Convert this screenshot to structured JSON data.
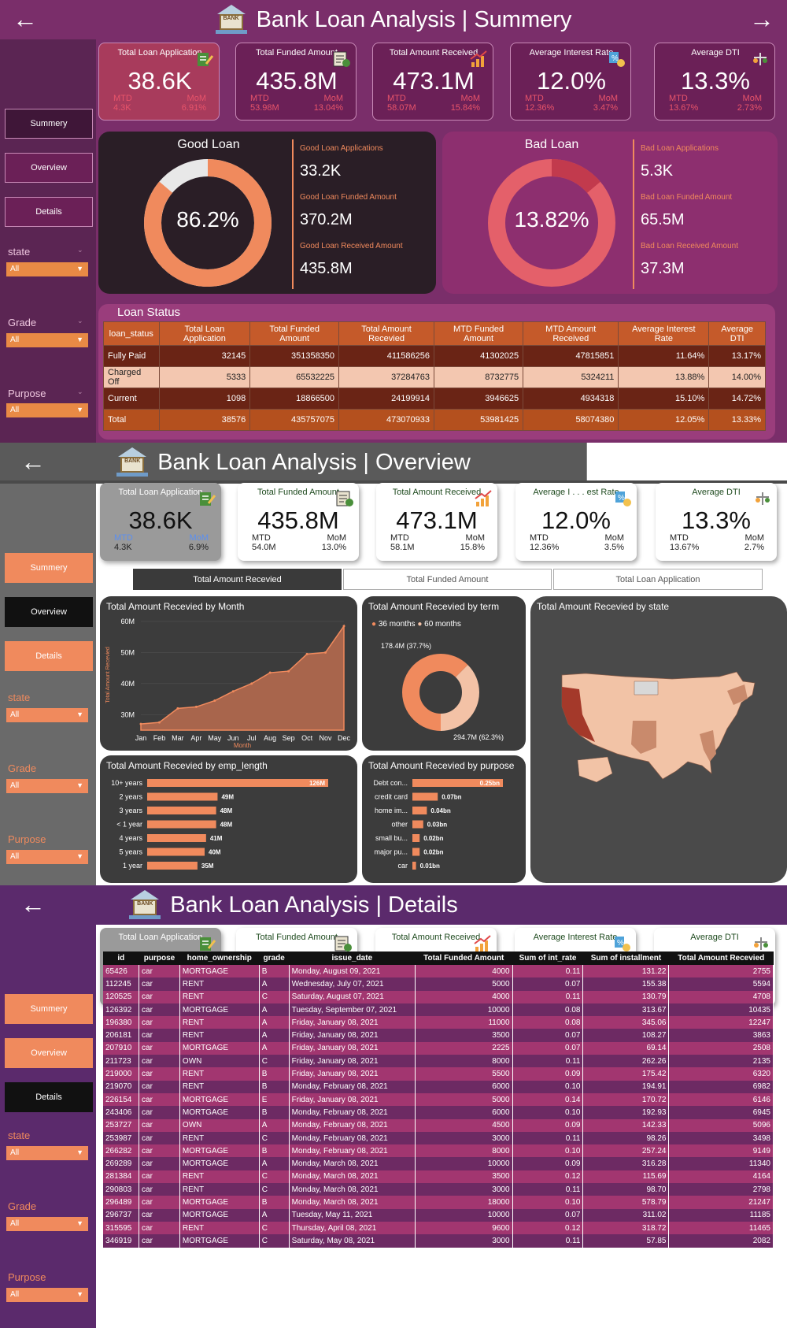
{
  "colors": {
    "summary_bg": "#7a2e6a",
    "overview_bg": "#4a4a4a",
    "details_bg": "#5b2a6c",
    "accent": "#f08a5d",
    "good": "#f08a5d",
    "bad": "#d9485b"
  },
  "summary": {
    "title": "Bank Loan Analysis | Summery",
    "nav": [
      "Summery",
      "Overview",
      "Details"
    ],
    "filters": [
      {
        "label": "state",
        "value": "All"
      },
      {
        "label": "Grade",
        "value": "All"
      },
      {
        "label": "Purpose",
        "value": "All"
      }
    ],
    "kpis": [
      {
        "title": "Total Loan Application",
        "value": "38.6K",
        "mtd_label": "MTD",
        "mtd": "4.3K",
        "mom_label": "MoM",
        "mom": "6.91%",
        "icon": "application-icon"
      },
      {
        "title": "Total Funded Amount",
        "value": "435.8M",
        "mtd_label": "MTD",
        "mtd": "53.98M",
        "mom_label": "MoM",
        "mom": "13.04%",
        "icon": "funded-icon"
      },
      {
        "title": "Total Amount Received",
        "value": "473.1M",
        "mtd_label": "MTD",
        "mtd": "58.07M",
        "mom_label": "MoM",
        "mom": "15.84%",
        "icon": "received-icon"
      },
      {
        "title": "Average Interest Rate",
        "value": "12.0%",
        "mtd_label": "MTD",
        "mtd": "12.36%",
        "mom_label": "MoM",
        "mom": "3.47%",
        "icon": "interest-icon"
      },
      {
        "title": "Average DTI",
        "value": "13.3%",
        "mtd_label": "MTD",
        "mtd": "13.67%",
        "mom_label": "MoM",
        "mom": "2.73%",
        "icon": "dti-icon"
      }
    ],
    "good": {
      "title": "Good Loan",
      "pct": "86.2%",
      "pct_value": 86.2,
      "apps_label": "Good Loan Applications",
      "apps": "33.2K",
      "funded_label": "Good Loan Funded Amount",
      "funded": "370.2M",
      "received_label": "Good Loan Received Amount",
      "received": "435.8M"
    },
    "bad": {
      "title": "Bad Loan",
      "pct": "13.82%",
      "pct_value": 13.82,
      "apps_label": "Bad Loan Applications",
      "apps": "5.3K",
      "funded_label": "Bad Loan Funded Amount",
      "funded": "65.5M",
      "received_label": "Bad Loan Received Amount",
      "received": "37.3M"
    },
    "status_title": "Loan Status",
    "status_cols": [
      "loan_status",
      "Total Loan Application",
      "Total Funded Amount",
      "Total Amount Recevied",
      "MTD Funded Amount",
      "MTD Amount Received",
      "Average Interest Rate",
      "Average DTI"
    ],
    "status_rows": [
      [
        "Fully Paid",
        "32145",
        "351358350",
        "411586256",
        "41302025",
        "47815851",
        "11.64%",
        "13.17%"
      ],
      [
        "Charged Off",
        "5333",
        "65532225",
        "37284763",
        "8732775",
        "5324211",
        "13.88%",
        "14.00%"
      ],
      [
        "Current",
        "1098",
        "18866500",
        "24199914",
        "3946625",
        "4934318",
        "15.10%",
        "14.72%"
      ],
      [
        "Total",
        "38576",
        "435757075",
        "473070933",
        "53981425",
        "58074380",
        "12.05%",
        "13.33%"
      ]
    ]
  },
  "overview": {
    "title": "Bank Loan Analysis | Overview",
    "kpis": [
      {
        "title": "Total Loan Application",
        "value": "38.6K",
        "mtd_label": "MTD",
        "mtd": "4.3K",
        "mom_label": "MoM",
        "mom": "6.9%"
      },
      {
        "title": "Total Funded Amount",
        "value": "435.8M",
        "mtd_label": "MTD",
        "mtd": "54.0M",
        "mom_label": "MoM",
        "mom": "13.0%"
      },
      {
        "title": "Total Amount Received",
        "value": "473.1M",
        "mtd_label": "MTD",
        "mtd": "58.1M",
        "mom_label": "MoM",
        "mom": "15.8%"
      },
      {
        "title": "Average I . . . est Rate",
        "value": "12.0%",
        "mtd_label": "MTD",
        "mtd": "12.36%",
        "mom_label": "MoM",
        "mom": "3.5%"
      },
      {
        "title": "Average DTI",
        "value": "13.3%",
        "mtd_label": "MTD",
        "mtd": "13.67%",
        "mom_label": "MoM",
        "mom": "2.7%"
      }
    ],
    "tabs": [
      "Total Amount Recevied",
      "Total Funded Amount",
      "Total Loan Application"
    ],
    "month_title": "Total Amount Recevied by Month",
    "term_title": "Total Amount Recevied by term",
    "state_title": "Total Amount Recevied by state",
    "emp_title": "Total Amount Recevied by emp_length",
    "purpose_title": "Total Amount Recevied by purpose",
    "term_legend": [
      "36 months",
      "60 months"
    ],
    "term_labels": [
      "178.4M (37.7%)",
      "294.7M (62.3%)"
    ]
  },
  "details": {
    "title": "Bank Loan Analysis | Details",
    "columns": [
      "id",
      "purpose",
      "home_ownership",
      "grade",
      "issue_date",
      "Total Funded Amount",
      "Sum of int_rate",
      "Sum of installment",
      "Total Amount Recevied"
    ],
    "rows": [
      [
        "65426",
        "car",
        "MORTGAGE",
        "B",
        "Monday, August 09, 2021",
        "4000",
        "0.11",
        "131.22",
        "2755"
      ],
      [
        "112245",
        "car",
        "RENT",
        "A",
        "Wednesday, July 07, 2021",
        "5000",
        "0.07",
        "155.38",
        "5594"
      ],
      [
        "120525",
        "car",
        "RENT",
        "C",
        "Saturday, August 07, 2021",
        "4000",
        "0.11",
        "130.79",
        "4708"
      ],
      [
        "126392",
        "car",
        "MORTGAGE",
        "A",
        "Tuesday, September 07, 2021",
        "10000",
        "0.08",
        "313.67",
        "10435"
      ],
      [
        "196380",
        "car",
        "RENT",
        "A",
        "Friday, January 08, 2021",
        "11000",
        "0.08",
        "345.06",
        "12247"
      ],
      [
        "206181",
        "car",
        "RENT",
        "A",
        "Friday, January 08, 2021",
        "3500",
        "0.07",
        "108.27",
        "3863"
      ],
      [
        "207910",
        "car",
        "MORTGAGE",
        "A",
        "Friday, January 08, 2021",
        "2225",
        "0.07",
        "69.14",
        "2508"
      ],
      [
        "211723",
        "car",
        "OWN",
        "C",
        "Friday, January 08, 2021",
        "8000",
        "0.11",
        "262.26",
        "2135"
      ],
      [
        "219000",
        "car",
        "RENT",
        "B",
        "Friday, January 08, 2021",
        "5500",
        "0.09",
        "175.42",
        "6320"
      ],
      [
        "219070",
        "car",
        "RENT",
        "B",
        "Monday, February 08, 2021",
        "6000",
        "0.10",
        "194.91",
        "6982"
      ],
      [
        "226154",
        "car",
        "MORTGAGE",
        "E",
        "Friday, January 08, 2021",
        "5000",
        "0.14",
        "170.72",
        "6146"
      ],
      [
        "243406",
        "car",
        "MORTGAGE",
        "B",
        "Monday, February 08, 2021",
        "6000",
        "0.10",
        "192.93",
        "6945"
      ],
      [
        "253727",
        "car",
        "OWN",
        "A",
        "Monday, February 08, 2021",
        "4500",
        "0.09",
        "142.33",
        "5096"
      ],
      [
        "253987",
        "car",
        "RENT",
        "C",
        "Monday, February 08, 2021",
        "3000",
        "0.11",
        "98.26",
        "3498"
      ],
      [
        "266282",
        "car",
        "MORTGAGE",
        "B",
        "Monday, February 08, 2021",
        "8000",
        "0.10",
        "257.24",
        "9149"
      ],
      [
        "269289",
        "car",
        "MORTGAGE",
        "A",
        "Monday, March 08, 2021",
        "10000",
        "0.09",
        "316.28",
        "11340"
      ],
      [
        "281384",
        "car",
        "RENT",
        "C",
        "Monday, March 08, 2021",
        "3500",
        "0.12",
        "115.69",
        "4164"
      ],
      [
        "290803",
        "car",
        "RENT",
        "C",
        "Monday, March 08, 2021",
        "3000",
        "0.11",
        "98.70",
        "2798"
      ],
      [
        "296489",
        "car",
        "MORTGAGE",
        "B",
        "Monday, March 08, 2021",
        "18000",
        "0.10",
        "578.79",
        "21247"
      ],
      [
        "296737",
        "car",
        "MORTGAGE",
        "A",
        "Tuesday, May 11, 2021",
        "10000",
        "0.07",
        "311.02",
        "11185"
      ],
      [
        "315595",
        "car",
        "RENT",
        "C",
        "Thursday, April 08, 2021",
        "9600",
        "0.12",
        "318.72",
        "11465"
      ],
      [
        "346919",
        "car",
        "MORTGAGE",
        "C",
        "Saturday, May 08, 2021",
        "3000",
        "0.11",
        "57.85",
        "2082"
      ]
    ]
  },
  "chart_data": [
    {
      "type": "area",
      "title": "Total Amount Recevied by Month",
      "xlabel": "Month",
      "ylabel": "Total Amount Recevied",
      "categories": [
        "Jan",
        "Feb",
        "Mar",
        "Apr",
        "May",
        "Jun",
        "Jul",
        "Aug",
        "Sep",
        "Oct",
        "Nov",
        "Dec"
      ],
      "values": [
        27.0,
        27.5,
        32.0,
        32.5,
        34.5,
        37.5,
        40.0,
        43.5,
        44.0,
        49.5,
        50.0,
        58.5
      ],
      "ylim": [
        25,
        60
      ],
      "yticks": [
        "30M",
        "40M",
        "50M",
        "60M"
      ]
    },
    {
      "type": "pie",
      "title": "Total Amount Recevied by term",
      "categories": [
        "36 months",
        "60 months"
      ],
      "values": [
        294.7,
        178.4
      ],
      "labels": [
        "294.7M (62.3%)",
        "178.4M (37.7%)"
      ]
    },
    {
      "type": "bar",
      "title": "Total Amount Recevied by emp_length",
      "categories": [
        "10+ years",
        "2 years",
        "3 years",
        "< 1 year",
        "4 years",
        "5 years",
        "1 year"
      ],
      "values": [
        126,
        49,
        48,
        48,
        41,
        40,
        35
      ],
      "labels": [
        "126M",
        "49M",
        "48M",
        "48M",
        "41M",
        "40M",
        "35M"
      ]
    },
    {
      "type": "bar",
      "title": "Total Amount Recevied by purpose",
      "categories": [
        "Debt con...",
        "credit card",
        "home im...",
        "other",
        "small bu...",
        "major pu...",
        "car"
      ],
      "values": [
        0.25,
        0.07,
        0.04,
        0.03,
        0.02,
        0.02,
        0.01
      ],
      "labels": [
        "0.25bn",
        "0.07bn",
        "0.04bn",
        "0.03bn",
        "0.02bn",
        "0.02bn",
        "0.01bn"
      ]
    },
    {
      "type": "pie",
      "title": "Good Loan",
      "categories": [
        "Good Loan",
        "Bad Loan"
      ],
      "values": [
        86.2,
        13.8
      ]
    },
    {
      "type": "pie",
      "title": "Bad Loan",
      "categories": [
        "Bad Loan",
        "Good Loan"
      ],
      "values": [
        13.82,
        86.18
      ]
    }
  ]
}
